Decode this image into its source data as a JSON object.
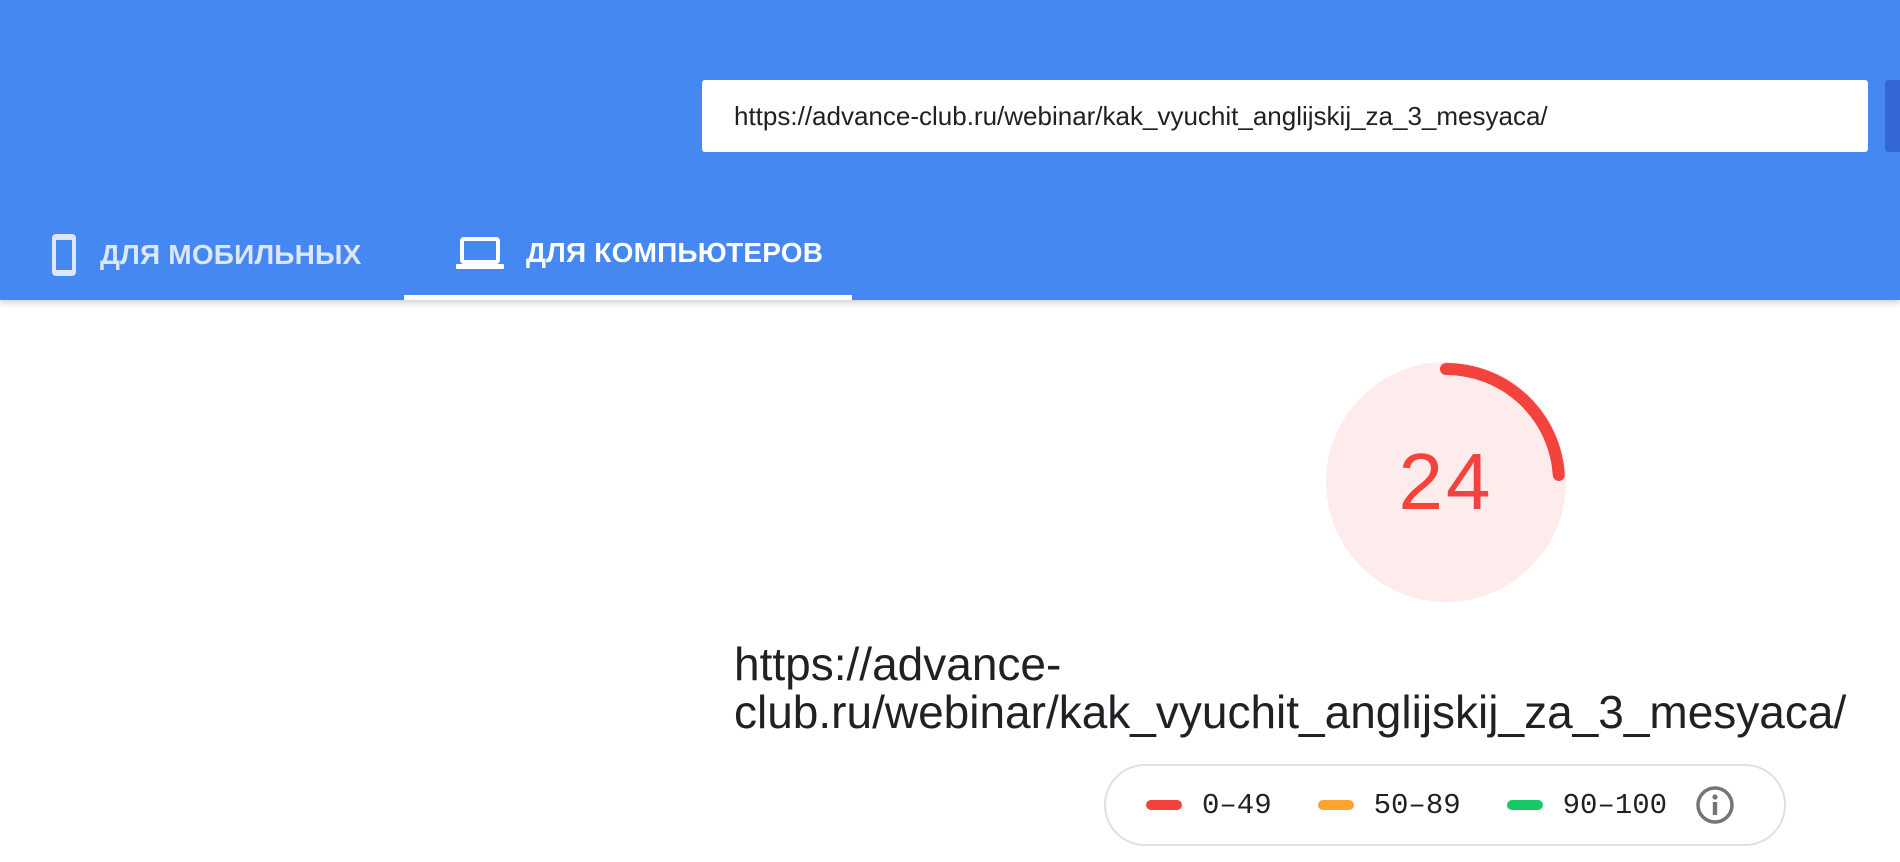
{
  "search": {
    "url_value": "https://advance-club.ru/webinar/kak_vyuchit_anglijskij_za_3_mesyaca/"
  },
  "tabs": [
    {
      "label": "ДЛЯ МОБИЛЬНЫХ",
      "icon": "smartphone-icon",
      "active": false
    },
    {
      "label": "ДЛЯ КОМПЬЮТЕРОВ",
      "icon": "laptop-icon",
      "active": true
    }
  ],
  "score": {
    "value": "24",
    "fraction": 0.24,
    "color": "#f4433c",
    "background": "#fdeceb"
  },
  "result": {
    "final_url": "https://advance-\nclub.ru/webinar/kak_vyuchit_anglijskij_za_3_mesyaca/"
  },
  "legend": {
    "items": [
      {
        "label": "0–49",
        "color": "#f4433c"
      },
      {
        "label": "50–89",
        "color": "#ffa330"
      },
      {
        "label": "90–100",
        "color": "#17c964"
      }
    ],
    "info_icon": "info-icon"
  },
  "colors": {
    "header": "#4688f1",
    "accent_button": "#3367d6"
  }
}
